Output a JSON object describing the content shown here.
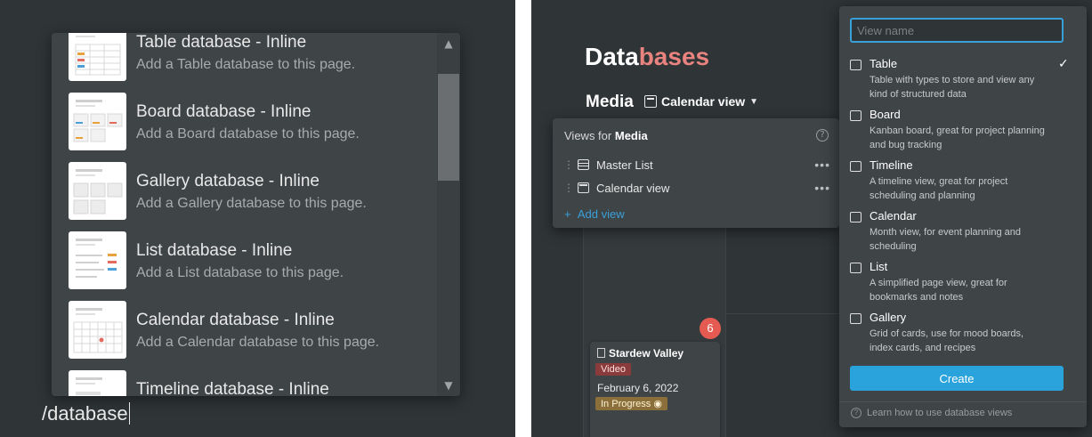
{
  "slash_menu": {
    "items": [
      {
        "title": "Table database - Inline",
        "desc": "Add a Table database to this page."
      },
      {
        "title": "Board database - Inline",
        "desc": "Add a Board database to this page."
      },
      {
        "title": "Gallery database - Inline",
        "desc": "Add a Gallery database to this page."
      },
      {
        "title": "List database - Inline",
        "desc": "Add a List database to this page."
      },
      {
        "title": "Calendar database - Inline",
        "desc": "Add a Calendar database to this page."
      },
      {
        "title": "Timeline database - Inline",
        "desc": ""
      }
    ],
    "command": "/database"
  },
  "page": {
    "title_part1": "Data",
    "title_part2": "bases",
    "database_name": "Media",
    "current_view": "Calendar view"
  },
  "views_popup": {
    "header_prefix": "Views for",
    "header_db": "Media",
    "views": [
      {
        "label": "Master List",
        "icon": "table-icon"
      },
      {
        "label": "Calendar view",
        "icon": "calendar-icon"
      }
    ],
    "add_label": "Add view"
  },
  "calendar": {
    "day_number": "6",
    "event": {
      "title": "Stardew Valley",
      "type_tag": "Video",
      "date": "February 6, 2022",
      "status_tag": "In Progress"
    }
  },
  "add_view_panel": {
    "input_placeholder": "View name",
    "types": [
      {
        "name": "Table",
        "desc": "Table with types to store and view any kind of structured data",
        "icon": "table-icon",
        "selected": true
      },
      {
        "name": "Board",
        "desc": "Kanban board, great for project planning and bug tracking",
        "icon": "board-icon"
      },
      {
        "name": "Timeline",
        "desc": "A timeline view, great for project scheduling and planning",
        "icon": "timeline-icon"
      },
      {
        "name": "Calendar",
        "desc": "Month view, for event planning and scheduling",
        "icon": "calendar-icon"
      },
      {
        "name": "List",
        "desc": "A simplified page view, great for bookmarks and notes",
        "icon": "list-icon"
      },
      {
        "name": "Gallery",
        "desc": "Grid of cards, use for mood boards, index cards, and recipes",
        "icon": "gallery-icon"
      }
    ],
    "create_label": "Create",
    "help_label": "Learn how to use database views"
  },
  "colors": {
    "background": "#2f3437",
    "popup": "#3f4447",
    "accent_blue": "#2aa3dc",
    "title_red": "#e9837f",
    "badge_red": "#e55b52"
  }
}
